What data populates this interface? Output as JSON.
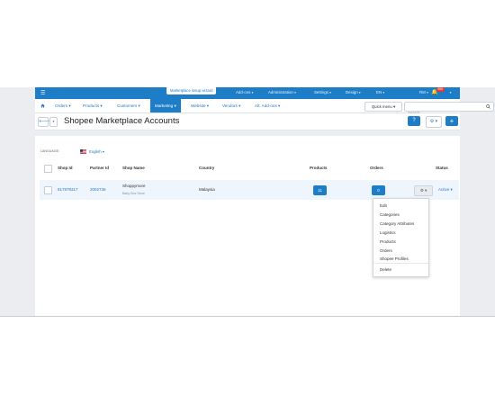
{
  "topbar": {
    "wizard_label": "Marketplace setup wizard",
    "items": [
      "Add-ons",
      "Administration",
      "Settings",
      "Design",
      "EN"
    ],
    "notification_count": "600",
    "user": "RM"
  },
  "nav": {
    "items": [
      "Orders",
      "Products",
      "Customers",
      "Marketing",
      "Website",
      "Vendors",
      "Alt. Add-ons"
    ],
    "active": "Marketing",
    "quick_menu": "Quick menu",
    "search_placeholder": "Search"
  },
  "page": {
    "title": "Shopee Marketplace Accounts"
  },
  "language": {
    "label": "LANGUAGE:",
    "value": "English"
  },
  "table": {
    "headers": [
      "Shop Id",
      "Partner Id",
      "Shop Name",
      "Country",
      "Products",
      "Orders",
      "Status"
    ],
    "rows": [
      {
        "shop_id": "817878317",
        "partner_id": "2002736",
        "shop_name": "Shoppymore",
        "shop_subtitle": "Baby Box Store",
        "country": "Malaysia",
        "products_count": "11",
        "orders_count": "0",
        "status": "Active"
      }
    ]
  },
  "actions_menu": {
    "items": [
      "Edit",
      "Categories",
      "Category Attributes",
      "Logistics",
      "Products",
      "Orders",
      "Shopee Profiles"
    ],
    "delete": "Delete"
  },
  "colors": {
    "primary": "#1d7ec7",
    "link": "#2b78c2",
    "background": "#ebedf0"
  }
}
